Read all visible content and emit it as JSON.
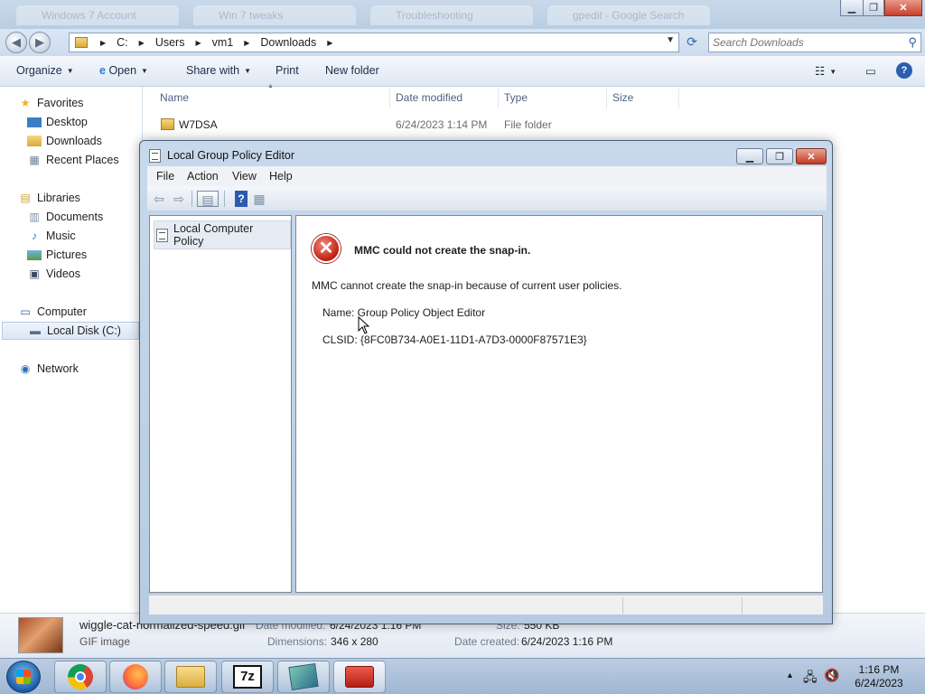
{
  "explorer": {
    "background_tabs": [
      "Windows 7 Account",
      "Win 7 tweaks",
      "Troubleshooting",
      "gpedit - Google Search"
    ],
    "breadcrumbs": [
      "C:",
      "Users",
      "vm1",
      "Downloads"
    ],
    "search_placeholder": "Search Downloads",
    "commands": {
      "organize": "Organize",
      "open": "Open",
      "share_with": "Share with",
      "print": "Print",
      "new_folder": "New folder"
    },
    "favorites": {
      "header": "Favorites",
      "items": [
        "Desktop",
        "Downloads",
        "Recent Places"
      ]
    },
    "libraries": {
      "header": "Libraries",
      "items": [
        "Documents",
        "Music",
        "Pictures",
        "Videos"
      ]
    },
    "computer": {
      "header": "Computer",
      "items": [
        "Local Disk (C:)"
      ]
    },
    "network": "Network",
    "columns": {
      "name": "Name",
      "date": "Date modified",
      "type": "Type",
      "size": "Size"
    },
    "files": [
      {
        "name": "W7DSA",
        "date": "6/24/2023 1:14 PM",
        "type": "File folder",
        "size": ""
      }
    ],
    "details": {
      "filename": "wiggle-cat-normalized-speed.gif",
      "filetype": "GIF image",
      "date_modified_label": "Date modified:",
      "date_modified": "6/24/2023 1:16 PM",
      "size_label": "Size:",
      "size": "550 KB",
      "dimensions_label": "Dimensions:",
      "dimensions": "346 x 280",
      "date_created_label": "Date created:",
      "date_created": "6/24/2023 1:16 PM"
    }
  },
  "mmc": {
    "title": "Local Group Policy Editor",
    "menu": [
      "File",
      "Action",
      "View",
      "Help"
    ],
    "tree_item": "Local Computer Policy",
    "error": {
      "title": "MMC could not create the snap-in.",
      "message": "MMC cannot create the snap-in because of current user policies.",
      "name_line": "Name: Group Policy Object Editor",
      "clsid_line": "CLSID: {8FC0B734-A0E1-11D1-A7D3-0000F87571E3}"
    }
  },
  "taskbar": {
    "apps": [
      "chrome-icon",
      "firefox-icon",
      "explorer-icon",
      "7zip-icon",
      "mmc-icon",
      "toolbox-icon"
    ],
    "time": "1:16 PM",
    "date": "6/24/2023"
  }
}
